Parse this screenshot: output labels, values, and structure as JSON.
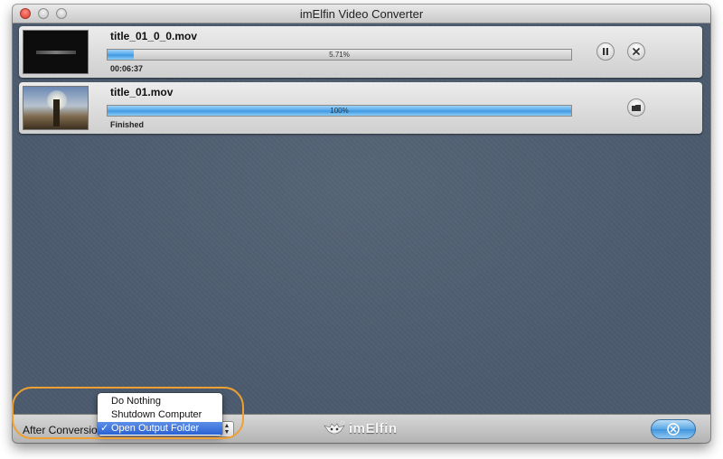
{
  "window": {
    "title": "imElfin Video Converter"
  },
  "conversions": [
    {
      "filename": "title_01_0_0.mov",
      "progress_text": "5.71%",
      "progress": 0.0571,
      "status": "00:06:37",
      "controls": [
        "pause-icon",
        "close-icon"
      ]
    },
    {
      "filename": "title_01.mov",
      "progress_text": "100%",
      "progress": 1.0,
      "status": "Finished",
      "controls": [
        "folder-icon"
      ]
    }
  ],
  "bottom_bar": {
    "after_label": "After Conversion",
    "selected_option": "Open Output Folder",
    "brand": "imElfin",
    "close_button_icon": "close-icon"
  },
  "after_menu": {
    "options": [
      "Do Nothing",
      "Shutdown Computer",
      "Open Output Folder"
    ],
    "selected_index": 2,
    "check_glyph": "✓"
  },
  "colors": {
    "accent": "#3d95e0",
    "background": "#4b5b6e",
    "highlight": "#f0a030"
  }
}
